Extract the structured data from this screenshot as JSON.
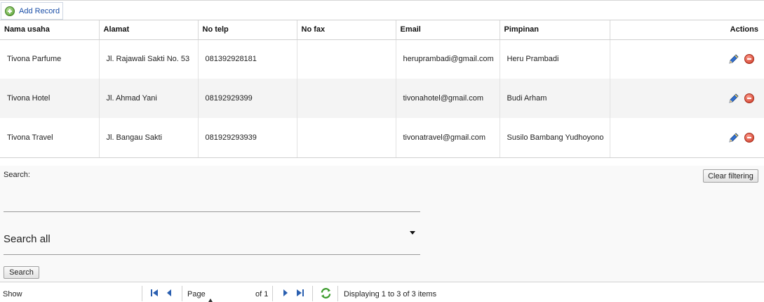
{
  "toolbar": {
    "add_label": "Add Record"
  },
  "table": {
    "columns": [
      "Nama usaha",
      "Alamat",
      "No telp",
      "No fax",
      "Email",
      "Pimpinan",
      "Actions"
    ],
    "rows": [
      {
        "nama": "Tivona Parfume",
        "alamat": "Jl. Rajawali Sakti No. 53",
        "telp": "081392928181",
        "fax": "",
        "email": "heruprambadi@gmail.com",
        "pimpinan": "Heru Prambadi"
      },
      {
        "nama": "Tivona Hotel",
        "alamat": "Jl. Ahmad Yani",
        "telp": "08192929399",
        "fax": "",
        "email": "tivonahotel@gmail.com",
        "pimpinan": "Budi Arham"
      },
      {
        "nama": "Tivona Travel",
        "alamat": "Jl. Bangau Sakti",
        "telp": "081929293939",
        "fax": "",
        "email": "tivonatravel@gmail.com",
        "pimpinan": "Susilo Bambang Yudhoyono"
      }
    ],
    "row_icons": [
      "pencil-icon",
      "delete-icon"
    ]
  },
  "search": {
    "label": "Search:",
    "clear_label": "Clear filtering",
    "input_value": "",
    "field_selected": "Search all",
    "button_label": "Search"
  },
  "pager": {
    "show_label": "Show",
    "page_label": "Page",
    "page_value": "",
    "of_label": "of 1",
    "display_text": "Displaying 1 to 3 of 3 items"
  },
  "colors": {
    "link": "#1b4fa8",
    "alt_row": "#f4f4f4",
    "panel": "#f9f9f9",
    "border": "#d0d0d0"
  }
}
